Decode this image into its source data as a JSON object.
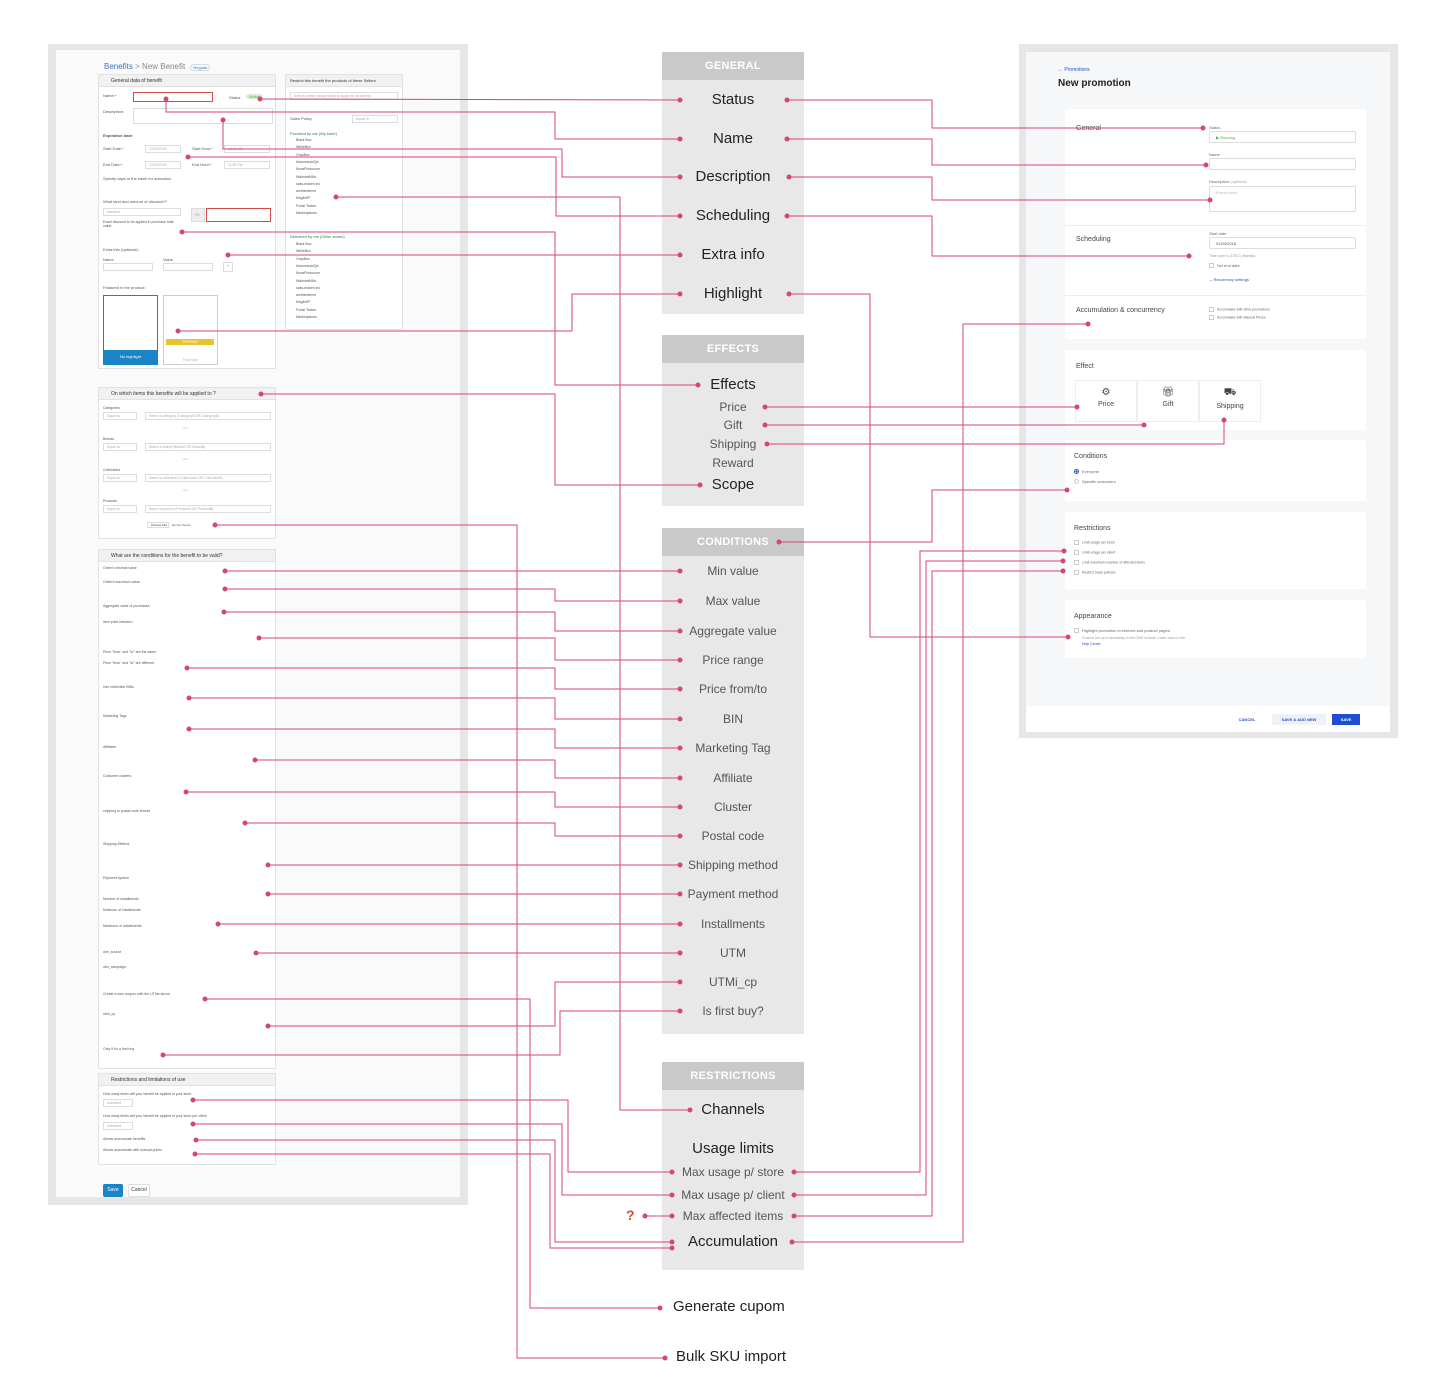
{
  "legacy": {
    "breadcrumb": {
      "root": "Benefits",
      "separator": ">",
      "current": "New Benefit",
      "tag": "Regular"
    },
    "section1": {
      "title": "General data of benefit",
      "name_label": "Name:*",
      "status_label": "Status",
      "status_value": "Active",
      "description_label": "Description:",
      "expiration": "Expiration date:",
      "start_date_label": "Start Date:*",
      "start_date": "12/03/2018",
      "start_hour_label": "Start Hour:*",
      "start_hour": "12:00 AM",
      "end_date_label": "End Date:*",
      "end_date": "12/03/2018",
      "end_hour_label": "End Hour:*",
      "end_hour": "11:59 PM",
      "weekdays": "Specify days of the week for activation",
      "discount_label": "What kind and amount of discount?*",
      "discount_type": "Nominal",
      "currency": "R$",
      "discount_hint": "Exact discount to be applied in purchase total value.",
      "extra_info": "Extra info (optional):",
      "extra_name": "Name",
      "extra_value": "Value",
      "featured": "Featured in the product:",
      "no_highlight": "No highlight",
      "highlight": "Highlight",
      "promo": "PROMO"
    },
    "sellers": {
      "title": "Restrict this benefit the products of these Sellers",
      "placeholder": "Select a seller (leave blank to apply for all sellers)",
      "sales_policy": "Sales Policy",
      "equal_to": "Equal to",
      "provided": "Provided by me (My store)",
      "delivered": "Delivered by me (Other stores)",
      "stores": [
        "Black Box",
        "WhiteBox",
        "GrayBox",
        "AutomacaoQA",
        "NovaPontocom",
        "WalmartMNo",
        "sass-makes inc",
        "ambientelxm",
        "MagMKP",
        "Portal Testes",
        "Marketplaces"
      ]
    },
    "section2": {
      "title": "On which items this benefits will be applied to ?",
      "rows": [
        {
          "label": "Categories",
          "placeholder": "Select a category (CategoryA OR CategoryB)"
        },
        {
          "label": "Brands",
          "placeholder": "Select a brand (BrandA OR BrandB)"
        },
        {
          "label": "Collections",
          "placeholder": "Select a collection (CollectionA OR CollectionB)"
        },
        {
          "label": "Products",
          "placeholder": "Select a product (ProductA OR ProductB)"
        }
      ],
      "and": "and",
      "equal_to": "Equal to",
      "file_button": "Choose File",
      "file_none": "No file chosen"
    },
    "section3": {
      "title": "What are the conditions for the benefit to be valid?",
      "rows": [
        "Order's minimal value",
        "Order's maximum value",
        "Aggregate value of purchases",
        "Item price between",
        "Price \"from\" and \"to\" are the same",
        "Price \"from\" and \"to\" are different",
        "Use restriction BINs",
        "Marketing Tags",
        "Affiliates",
        "Customer clusters",
        "shipping to postal code should",
        "Shipping Method",
        "Payment system",
        "Number of installments",
        "Minimum of installments",
        "Maximum of installments",
        "utm_source",
        "utm_campaign",
        "Create a new coupon with the UTMs above",
        "utmi_cp",
        "Only if it's a first buy"
      ]
    },
    "section4": {
      "title": "Restrictions and limitations of use",
      "q1": "How many times will your benefit be applied in your store",
      "q2": "How many times will your benefit be applied in your store per client",
      "unlimited": "unlimited",
      "accum1": "Allows accumulate benefits",
      "accum2": "Allows accumulate with manual prices"
    },
    "save": "Save",
    "cancel": "Cancel"
  },
  "mapping": {
    "general": {
      "title": "GENERAL",
      "items": [
        "Status",
        "Name",
        "Description",
        "Scheduling",
        "Extra info",
        "Highlight"
      ]
    },
    "effects": {
      "title": "EFFECTS",
      "items": [
        "Effects",
        "Price",
        "Gift",
        "Shipping",
        "Reward",
        "Scope"
      ]
    },
    "conditions": {
      "title": "CONDITIONS",
      "items": [
        "Min value",
        "Max value",
        "Aggregate value",
        "Price range",
        "Price from/to",
        "BIN",
        "Marketing Tag",
        "Affiliate",
        "Cluster",
        "Postal code",
        "Shipping method",
        "Payment method",
        "Installments",
        "UTM",
        "UTMi_cp",
        "Is first buy?"
      ]
    },
    "restrictions": {
      "title": "RESTRICTIONS",
      "items": [
        "Channels",
        "Usage limits",
        "Max usage p/ store",
        "Max usage p/ client",
        "Max affected items",
        "Accumulation"
      ]
    },
    "unmapped_marker": "?",
    "extra": [
      "Generate cupom",
      "Bulk SKU import"
    ],
    "line_color": "#d6457a"
  },
  "new_ui": {
    "back": "← Promotions",
    "title": "New promotion",
    "general": {
      "title": "General",
      "status_label": "Status",
      "status_value": "▶ Running",
      "name_label": "Name",
      "description_label": "Description",
      "optional": "(optional)",
      "placeholder": "Placeholder"
    },
    "scheduling": {
      "title": "Scheduling",
      "start_label": "Start date",
      "start_value": "01/04/2018",
      "timezone": "Time zone is GTM-3 (Brasilia).",
      "end_date": "Set end date",
      "recurrency": "Recurrency settings"
    },
    "accumulation": {
      "title": "Accumulation & concurrency",
      "opt1": "Accumulate with other promotions",
      "opt2": "Accumulate with Manual Prices"
    },
    "effect": {
      "title": "Effect",
      "options": [
        "Price",
        "Gift",
        "Shipping"
      ]
    },
    "conditions": {
      "title": "Conditions",
      "opt1": "Everyone",
      "opt2": "Specific customers"
    },
    "restrictions": {
      "title": "Restrictions",
      "opts": [
        "Limit usage per store",
        "Limit usage per client",
        "Limit maximum number of affected items",
        "Restrict trade policies"
      ]
    },
    "appearance": {
      "title": "Appearance",
      "opt": "Highlight promotion in shelves and product pages.",
      "hint": "Custom set up is necessary in the CMS module. Learn more in the",
      "link": "Help Center"
    },
    "footer": {
      "cancel": "CANCEL",
      "save_add": "SAVE & ADD NEW",
      "save": "SAVE"
    },
    "accent": "#1f4fd1"
  }
}
